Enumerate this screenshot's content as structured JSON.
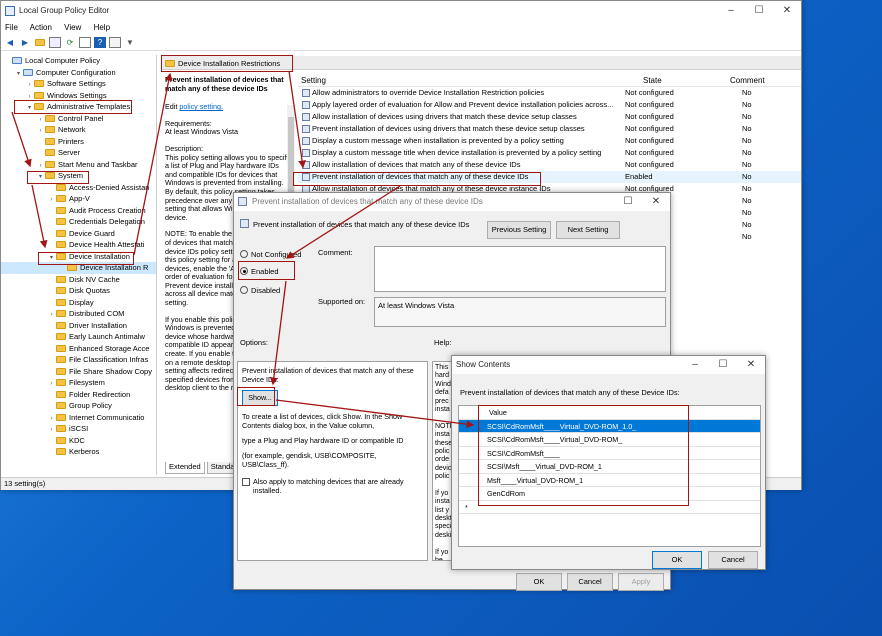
{
  "gpedit": {
    "title": "Local Group Policy Editor",
    "menu": [
      "File",
      "Action",
      "View",
      "Help"
    ],
    "status": "13 setting(s)",
    "tree": [
      {
        "label": "Local Computer Policy",
        "level": 0,
        "arrow": ""
      },
      {
        "label": "Computer Configuration",
        "level": 1,
        "arrow": "▾"
      },
      {
        "label": "Software Settings",
        "level": 2,
        "arrow": "›"
      },
      {
        "label": "Windows Settings",
        "level": 2,
        "arrow": "›"
      },
      {
        "label": "Administrative Templates",
        "level": 2,
        "arrow": "▾"
      },
      {
        "label": "Control Panel",
        "level": 3,
        "arrow": "›"
      },
      {
        "label": "Network",
        "level": 3,
        "arrow": "›"
      },
      {
        "label": "Printers",
        "level": 3,
        "arrow": ""
      },
      {
        "label": "Server",
        "level": 3,
        "arrow": ""
      },
      {
        "label": "Start Menu and Taskbar",
        "level": 3,
        "arrow": "›"
      },
      {
        "label": "System",
        "level": 3,
        "arrow": "▾"
      },
      {
        "label": "Access-Denied Assistan",
        "level": 4,
        "arrow": ""
      },
      {
        "label": "App-V",
        "level": 4,
        "arrow": "›"
      },
      {
        "label": "Audit Process Creation",
        "level": 4,
        "arrow": ""
      },
      {
        "label": "Credentials Delegation",
        "level": 4,
        "arrow": ""
      },
      {
        "label": "Device Guard",
        "level": 4,
        "arrow": ""
      },
      {
        "label": "Device Health Attestati",
        "level": 4,
        "arrow": ""
      },
      {
        "label": "Device Installation",
        "level": 4,
        "arrow": "▾"
      },
      {
        "label": "Device Installation R",
        "level": 5,
        "arrow": ""
      },
      {
        "label": "Disk NV Cache",
        "level": 4,
        "arrow": ""
      },
      {
        "label": "Disk Quotas",
        "level": 4,
        "arrow": ""
      },
      {
        "label": "Display",
        "level": 4,
        "arrow": ""
      },
      {
        "label": "Distributed COM",
        "level": 4,
        "arrow": "›"
      },
      {
        "label": "Driver Installation",
        "level": 4,
        "arrow": ""
      },
      {
        "label": "Early Launch Antimalw",
        "level": 4,
        "arrow": ""
      },
      {
        "label": "Enhanced Storage Acce",
        "level": 4,
        "arrow": ""
      },
      {
        "label": "File Classification Infras",
        "level": 4,
        "arrow": ""
      },
      {
        "label": "File Share Shadow Copy",
        "level": 4,
        "arrow": ""
      },
      {
        "label": "Filesystem",
        "level": 4,
        "arrow": "›"
      },
      {
        "label": "Folder Redirection",
        "level": 4,
        "arrow": ""
      },
      {
        "label": "Group Policy",
        "level": 4,
        "arrow": ""
      },
      {
        "label": "Internet Communicatio",
        "level": 4,
        "arrow": "›"
      },
      {
        "label": "iSCSI",
        "level": 4,
        "arrow": "›"
      },
      {
        "label": "KDC",
        "level": 4,
        "arrow": ""
      },
      {
        "label": "Kerberos",
        "level": 4,
        "arrow": ""
      }
    ],
    "header_folder": "Device Installation Restrictions",
    "desc": {
      "title": "Prevent installation of devices that match any of these device IDs",
      "edit_prefix": "Edit ",
      "edit_link": "policy setting.",
      "req_label": "Requirements:",
      "req_value": "At least Windows Vista",
      "desc_label": "Description:",
      "body1": "This policy setting allows you to specify a list of Plug and Play hardware IDs and compatible IDs for devices that Windows is prevented from installing. By default, this policy setting takes precedence over any other policy setting that allows Windows to install a device.",
      "body2": "NOTE: To enable the Allow installation of devices that match any of these device IDs policy setting to supersede this policy setting for applicable devices, enable the 'Apply layered order of evaluation for Allow and Prevent device installation policies across all device match criteria' policy setting.",
      "body3": "If you enable this policy setting, Windows is prevented from installing a device whose hardware ID or compatible ID appears in the list you create. If you enable this policy setting on a remote desktop server, the policy setting affects redirection of the specified devices from a remote desktop client to the remote"
    },
    "tabs": [
      "Extended",
      "Standard"
    ],
    "columns": {
      "setting": "Setting",
      "state": "State",
      "comment": "Comment"
    },
    "rows": [
      {
        "name": "Allow administrators to override Device Installation Restriction policies",
        "state": "Not configured",
        "comment": "No"
      },
      {
        "name": "Apply layered order of evaluation for Allow and Prevent device installation policies across...",
        "state": "Not configured",
        "comment": "No"
      },
      {
        "name": "Allow installation of devices using drivers that match these device setup classes",
        "state": "Not configured",
        "comment": "No"
      },
      {
        "name": "Prevent installation of devices using drivers that match these device setup classes",
        "state": "Not configured",
        "comment": "No"
      },
      {
        "name": "Display a custom message when installation is prevented by a policy setting",
        "state": "Not configured",
        "comment": "No"
      },
      {
        "name": "Display a custom message title when device installation is prevented by a policy setting",
        "state": "Not configured",
        "comment": "No"
      },
      {
        "name": "Allow installation of devices that match any of these device IDs",
        "state": "Not configured",
        "comment": "No"
      },
      {
        "name": "Prevent installation of devices that match any of these device IDs",
        "state": "Enabled",
        "comment": "No"
      },
      {
        "name": "Allow installation of devices that match any of these device instance IDs",
        "state": "Not configured",
        "comment": "No"
      },
      {
        "name": "",
        "state": "",
        "comment": "No"
      },
      {
        "name": "",
        "state": "",
        "comment": "No"
      },
      {
        "name": "",
        "state": "",
        "comment": "No"
      },
      {
        "name": "",
        "state": "",
        "comment": "No"
      }
    ]
  },
  "policy_dialog": {
    "title": "Prevent installation of devices that match any of these device IDs",
    "heading": "Prevent installation of devices that match any of these device IDs",
    "prev_btn": "Previous Setting",
    "next_btn": "Next Setting",
    "not_configured": "Not Configured",
    "enabled": "Enabled",
    "disabled": "Disabled",
    "comment_label": "Comment:",
    "supported_label": "Supported on:",
    "supported_value": "At least Windows Vista",
    "options_label": "Options:",
    "help_label": "Help:",
    "opt_text": "Prevent installation of devices that match any of these Device IDs:",
    "show_btn": "Show...",
    "opt_p1": "To create a list of devices, click Show. In the Show Contents dialog box, in the Value column,",
    "opt_p2": "type a Plug and Play hardware ID or compatible ID",
    "opt_p3": "(for example, gendisk, USB\\COMPOSITE, USB\\Class_ff).",
    "also_apply": "Also apply to matching devices that are already installed.",
    "help_lines": [
      "This",
      "hard",
      "Wind",
      "defa",
      "prec",
      "insta",
      "",
      "NOTE",
      "insta",
      "these",
      "polic",
      "orde",
      "devic",
      "polic",
      "",
      "If yo",
      "insta",
      "list y",
      "deskt",
      "speci",
      "deski",
      "",
      "If yo",
      "be in"
    ],
    "ok": "OK",
    "cancel": "Cancel",
    "apply": "Apply"
  },
  "show_dialog": {
    "title": "Show Contents",
    "label": "Prevent installation of devices that match any of these Device IDs:",
    "col": "Value",
    "values": [
      "SCSI\\CdRomMsft____Virtual_DVD-ROM_1.0_",
      "SCSI\\CdRomMsft____Virtual_DVD-ROM_",
      "SCSI\\CdRomMsft____",
      "SCSI\\Msft____Virtual_DVD-ROM_1",
      "Msft____Virtual_DVD-ROM_1",
      "GenCdRom",
      ""
    ],
    "new_marker": "*",
    "ok": "OK",
    "cancel": "Cancel"
  }
}
